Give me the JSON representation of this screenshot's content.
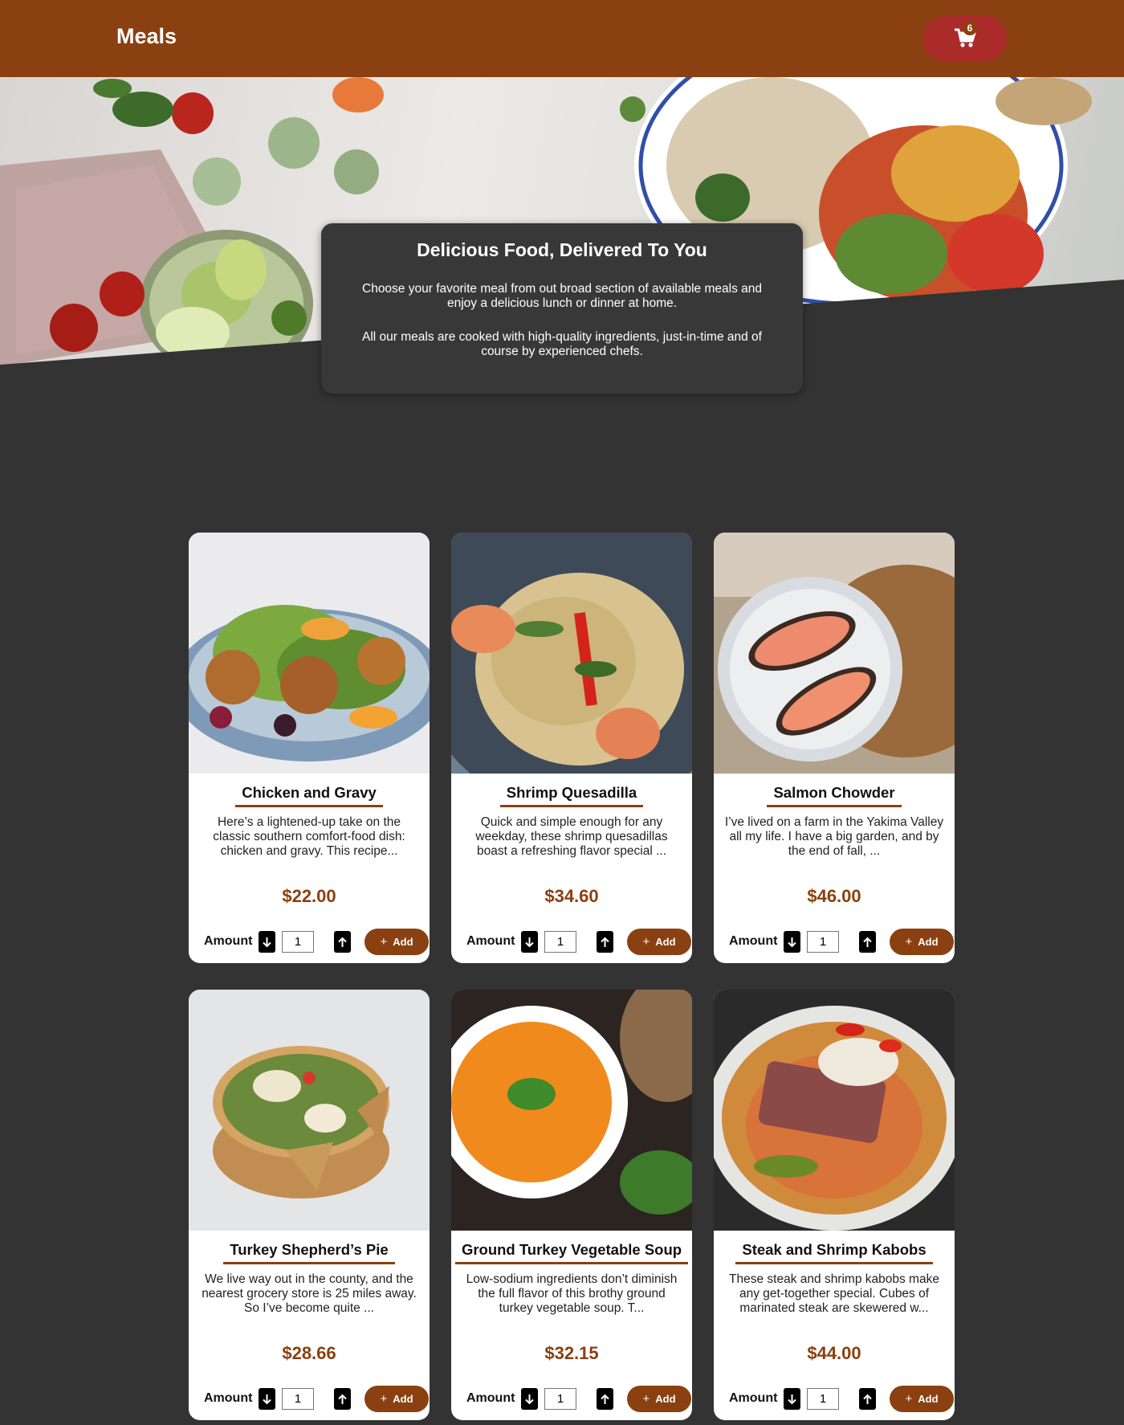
{
  "header": {
    "logo": "Meals",
    "cart_count": "6"
  },
  "hero": {
    "title": "Delicious Food, Delivered To You",
    "paragraph1": "Choose your favorite meal from out broad section of available meals and enjoy a delicious lunch or dinner at home.",
    "paragraph2": "All our meals are cooked with high-quality ingredients, just-in-time and of course by experienced chefs."
  },
  "meals": [
    {
      "title": "Chicken and Gravy",
      "description": "Here’s a lightened-up take on the classic southern comfort-food dish: chicken and gravy. This recipe...",
      "price": "$22.00",
      "amount_label": "Amount",
      "quantity": "1",
      "add_label": "Add"
    },
    {
      "title": "Shrimp Quesadilla",
      "description": "Quick and simple enough for any weekday, these shrimp quesadillas boast a refreshing flavor special ...",
      "price": "$34.60",
      "amount_label": "Amount",
      "quantity": "1",
      "add_label": "Add"
    },
    {
      "title": "Salmon Chowder",
      "description": "I’ve lived on a farm in the Yakima Valley all my life. I have a big garden, and by the end of fall, ...",
      "price": "$46.00",
      "amount_label": "Amount",
      "quantity": "1",
      "add_label": "Add"
    },
    {
      "title": "Turkey Shepherd’s Pie",
      "description": "We live way out in the county, and the nearest grocery store is 25 miles away. So I’ve become quite ...",
      "price": "$28.66",
      "amount_label": "Amount",
      "quantity": "1",
      "add_label": "Add"
    },
    {
      "title": "Ground Turkey Vegetable Soup",
      "description": "Low-sodium ingredients don’t diminish the full flavor of this brothy ground turkey vegetable soup. T...",
      "price": "$32.15",
      "amount_label": "Amount",
      "quantity": "1",
      "add_label": "Add"
    },
    {
      "title": "Steak and Shrimp Kabobs",
      "description": "These steak and shrimp kabobs make any get-together special. Cubes of marinated steak are skewered w...",
      "price": "$44.00",
      "amount_label": "Amount",
      "quantity": "1",
      "add_label": "Add"
    }
  ],
  "colors": {
    "brand": "#8a4010",
    "cart_button": "#ab2a2a",
    "page_background": "#333333",
    "hero_card": "#383838"
  },
  "icons": {
    "cart": "cart-icon",
    "decrease": "arrow-down-icon",
    "increase": "arrow-up-icon",
    "add": "plus-icon"
  }
}
